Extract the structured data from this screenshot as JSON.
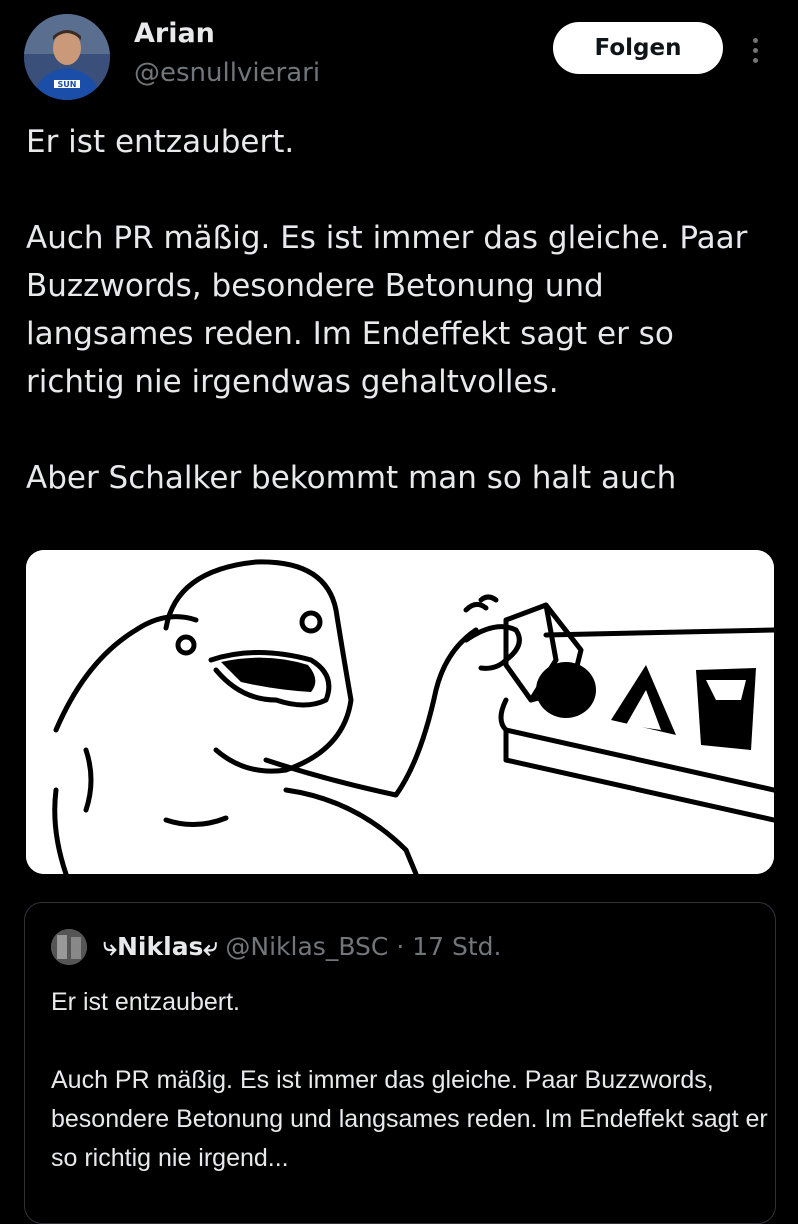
{
  "author": {
    "name": "Arian",
    "handle": "@esnullvierari",
    "avatar_jersey_text": "SUN"
  },
  "follow_label": "Folgen",
  "tweet": {
    "paragraphs": [
      "Er ist entzaubert.",
      "Auch PR mäßig. Es ist immer das gleiche. Paar Buzzwords, besondere Betonung und langsames reden. Im Endeffekt sagt er so richtig nie irgendwas gehaltvolles.",
      "Aber Schalker bekommt man so halt auch"
    ]
  },
  "media": {
    "description_icon": "wojak-shape-sorter-meme"
  },
  "quote": {
    "name": "⤷Niklas⤶",
    "handle": "@Niklas_BSC",
    "separator": "·",
    "time": "17 Std.",
    "paragraphs": [
      "Er ist entzaubert.",
      "Auch PR mäßig. Es ist immer das gleiche. Paar Buzzwords, besondere Betonung und langsames reden. Im Endeffekt sagt er so richtig nie irgend..."
    ]
  },
  "colors": {
    "background": "#000000",
    "text": "#e7e9ea",
    "secondary": "#71767b",
    "border": "#2f3336",
    "button_bg": "#ffffff"
  }
}
